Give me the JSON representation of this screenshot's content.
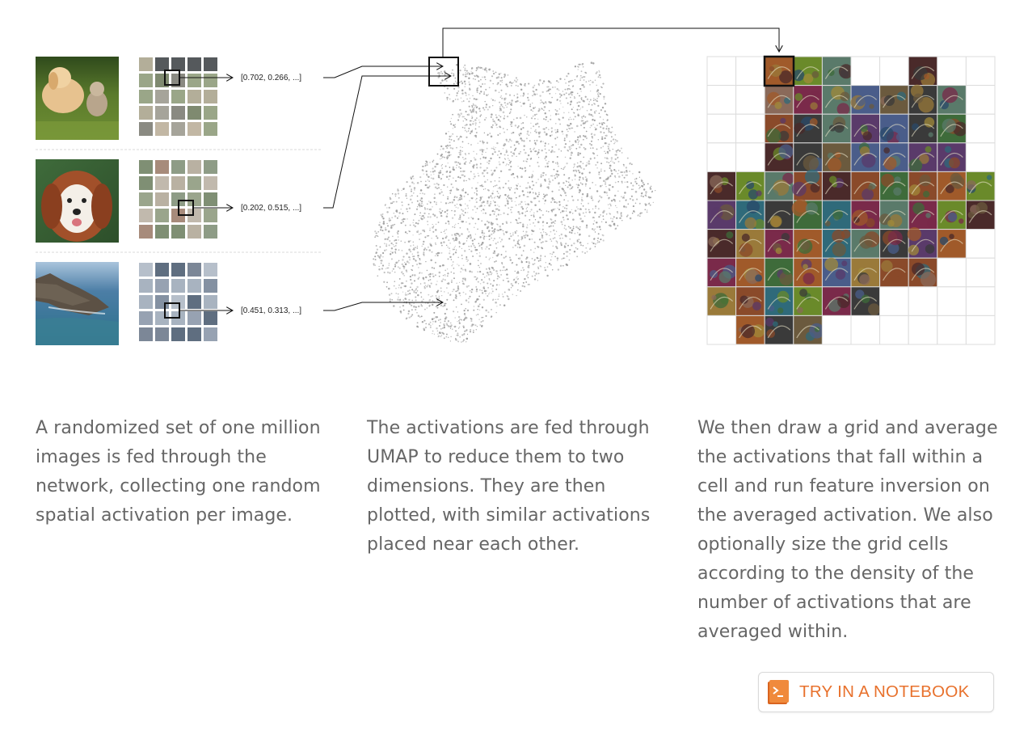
{
  "diagram": {
    "rows": [
      {
        "photo": "puppy-and-kitten",
        "vector_label": "[0.702, 0.266, ...]"
      },
      {
        "photo": "fluffy-dog",
        "vector_label": "[0.202, 0.515, ...]"
      },
      {
        "photo": "rocky-coastline",
        "vector_label": "[0.451, 0.313, ...]"
      }
    ],
    "scatter": {
      "description_icon": "umap-point-cloud",
      "color": "#9a9a9a"
    },
    "grid": {
      "columns": 10,
      "rows": 10,
      "icon": "feature-visualization-tiles"
    }
  },
  "captions": {
    "left": "A randomized set of one million images is fed through the network, collecting one random spatial activation per image.",
    "middle": "The activations are fed through UMAP to reduce them to two dimensions. They are then plotted, with similar activations placed near each other.",
    "right": "We then draw a grid and average the activations that fall within a cell and run feature inversion on the averaged activation. We also optionally size the grid cells according to the density of the number of activations that are averaged within."
  },
  "button": {
    "label": "TRY IN A NOTEBOOK",
    "icon": "notebook-icon",
    "color": "#e8712c"
  }
}
